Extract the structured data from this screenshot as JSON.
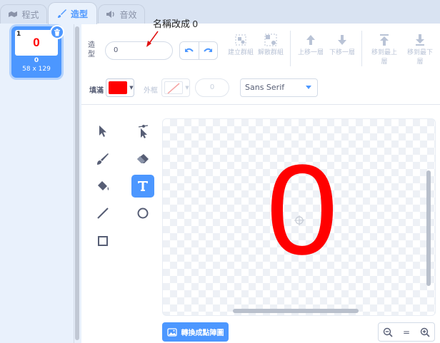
{
  "tabs": [
    {
      "label": "程式",
      "icon": "code-icon"
    },
    {
      "label": "造型",
      "icon": "brush-icon",
      "active": true
    },
    {
      "label": "音效",
      "icon": "speaker-icon"
    }
  ],
  "costume": {
    "index": "1",
    "thumbnail_text": "0",
    "name": "0",
    "size": "58 x 129"
  },
  "toolbar": {
    "costume_label": "造型",
    "name_value": "0",
    "group_label": "建立群組",
    "ungroup_label": "解散群組",
    "forward_label": "上移一層",
    "backward_label": "下移一層",
    "front_label": "移到最上層",
    "back_label": "移到最下層"
  },
  "annotation": "名稱改成 0",
  "style_bar": {
    "fill_label": "填滿",
    "fill_color": "#ff0000",
    "outline_label": "外框",
    "stroke_width": "0",
    "font": "Sans Serif"
  },
  "canvas": {
    "text": "0",
    "text_color": "#ff0000"
  },
  "bottom": {
    "convert_label": "轉換成點陣圖",
    "zoom_reset": "="
  },
  "colors": {
    "accent": "#4c97ff",
    "text": "#575e75"
  }
}
